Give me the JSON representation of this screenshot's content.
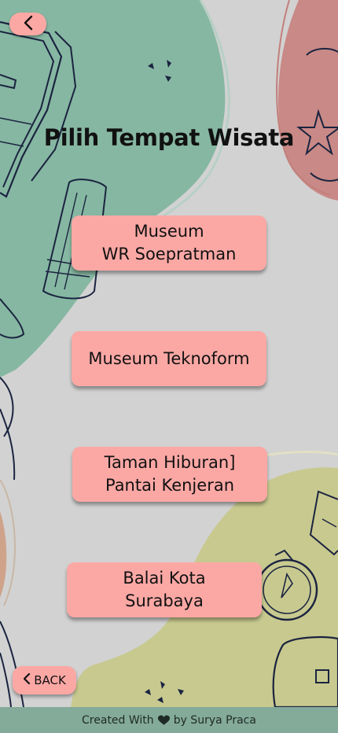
{
  "title": "Pilih Tempat Wisata",
  "top_back": {
    "icon": "chevron-left-icon"
  },
  "places": [
    {
      "label": "Museum\nWR Soepratman"
    },
    {
      "label": "Museum Teknoform"
    },
    {
      "label": "Taman Hiburan]\nPantai Kenjeran"
    },
    {
      "label": "Balai Kota\nSurabaya"
    }
  ],
  "bottom_back": {
    "label": "BACK",
    "icon": "chevron-left-icon"
  },
  "footer": {
    "prefix": "Created With",
    "icon": "heart-icon",
    "suffix": "by Surya Praca"
  },
  "colors": {
    "background": "#d2d2d2",
    "button": "#fba8a5",
    "green_blob": "#86b7a2",
    "red_blob": "#c98986",
    "olive_blob": "#c8c98f",
    "footer": "#84aa9a"
  }
}
